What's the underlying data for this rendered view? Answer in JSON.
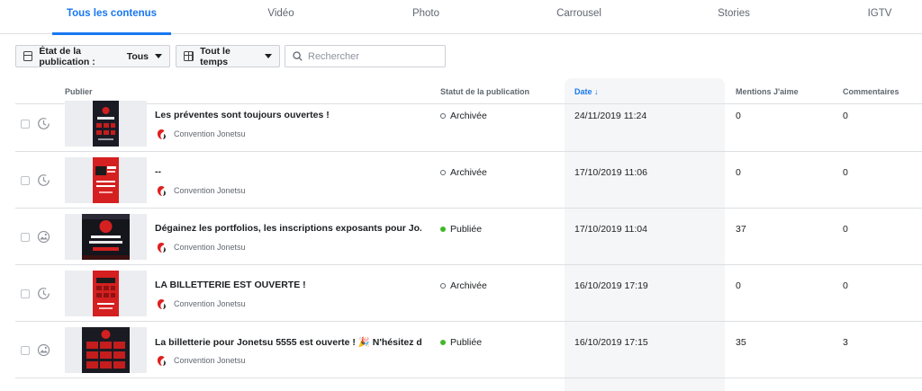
{
  "tabs": [
    {
      "label": "Tous les contenus",
      "active": true
    },
    {
      "label": "Vidéo",
      "active": false
    },
    {
      "label": "Photo",
      "active": false
    },
    {
      "label": "Carrousel",
      "active": false
    },
    {
      "label": "Stories",
      "active": false
    },
    {
      "label": "IGTV",
      "active": false
    }
  ],
  "toolbar": {
    "publication_state_label": "État de la publication :",
    "publication_state_value": "Tous",
    "time_range_label": "Tout le temps",
    "search_placeholder": "Rechercher"
  },
  "table": {
    "headers": {
      "publish": "Publier",
      "status": "Statut de la publication",
      "date": "Date ↓",
      "likes": "Mentions J'aime",
      "comments": "Commentaires"
    },
    "rows": [
      {
        "type_icon": "clock-icon",
        "thumb": "poster",
        "title": "Les préventes sont toujours ouvertes !",
        "page": "Convention Jonetsu",
        "status": "Archivée",
        "status_kind": "archived",
        "date": "24/11/2019 11:24",
        "likes": "0",
        "comments": "0"
      },
      {
        "type_icon": "clock-icon",
        "thumb": "red-poster",
        "title": "--",
        "page": "Convention Jonetsu",
        "status": "Archivée",
        "status_kind": "archived",
        "date": "17/10/2019 11:06",
        "likes": "0",
        "comments": "0"
      },
      {
        "type_icon": "image-icon",
        "thumb": "banner",
        "title": "Dégainez les portfolios, les inscriptions exposants pour Jo...",
        "page": "Convention Jonetsu",
        "status": "Publiée",
        "status_kind": "published",
        "date": "17/10/2019 11:04",
        "likes": "37",
        "comments": "0"
      },
      {
        "type_icon": "clock-icon",
        "thumb": "red-poster",
        "title": "LA BILLETTERIE EST OUVERTE !",
        "page": "Convention Jonetsu",
        "status": "Archivée",
        "status_kind": "archived",
        "date": "16/10/2019 17:19",
        "likes": "0",
        "comments": "0"
      },
      {
        "type_icon": "image-icon",
        "thumb": "ticket-grid",
        "title": "La billetterie pour Jonetsu 5555 est ouverte ! 🎉 N'hésitez d...",
        "page": "Convention Jonetsu",
        "status": "Publiée",
        "status_kind": "published",
        "date": "16/10/2019 17:15",
        "likes": "35",
        "comments": "3"
      }
    ]
  },
  "colors": {
    "accent": "#1877f2",
    "published": "#42b72a",
    "brand_red": "#e02020"
  }
}
